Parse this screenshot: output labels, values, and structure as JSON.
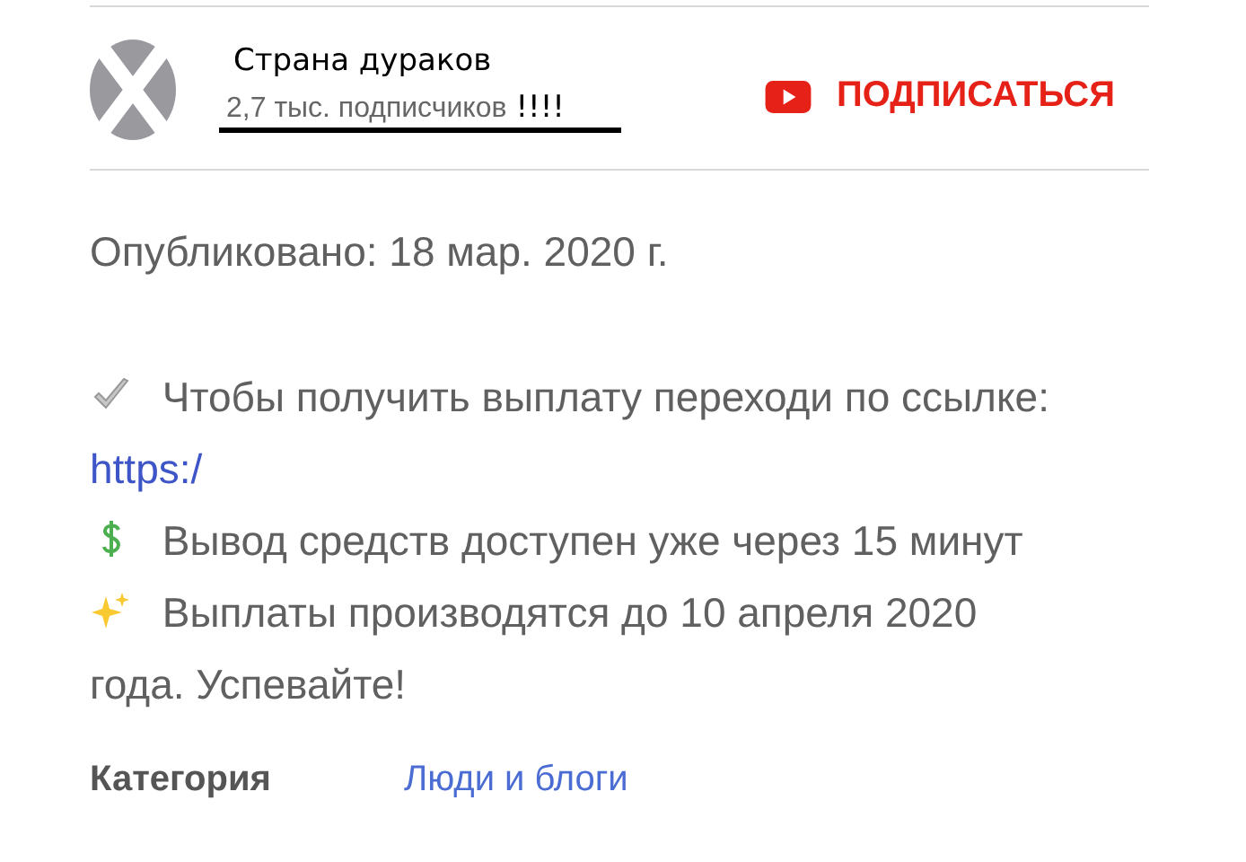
{
  "channel": {
    "name": "Страна дураков",
    "subscribers": "2,7 тыс. подписчиков",
    "annotation": "!!!!",
    "subscribe_label": "ПОДПИСАТЬСЯ"
  },
  "published": "Опубликовано: 18 мар. 2020 г.",
  "description": [
    {
      "kind": "check",
      "text": "Чтобы получить выплату переходи по ссылке:"
    },
    {
      "kind": "link",
      "text": "https:/"
    },
    {
      "kind": "dollar",
      "text": "Вывод средств доступен уже через 15 минут"
    },
    {
      "kind": "sparkles",
      "text": "Выплаты производятся до 10 апреля 2020"
    },
    {
      "kind": "plain",
      "text": "года. Успевайте!"
    }
  ],
  "category": {
    "label": "Категория",
    "value": "Люди и блоги"
  }
}
